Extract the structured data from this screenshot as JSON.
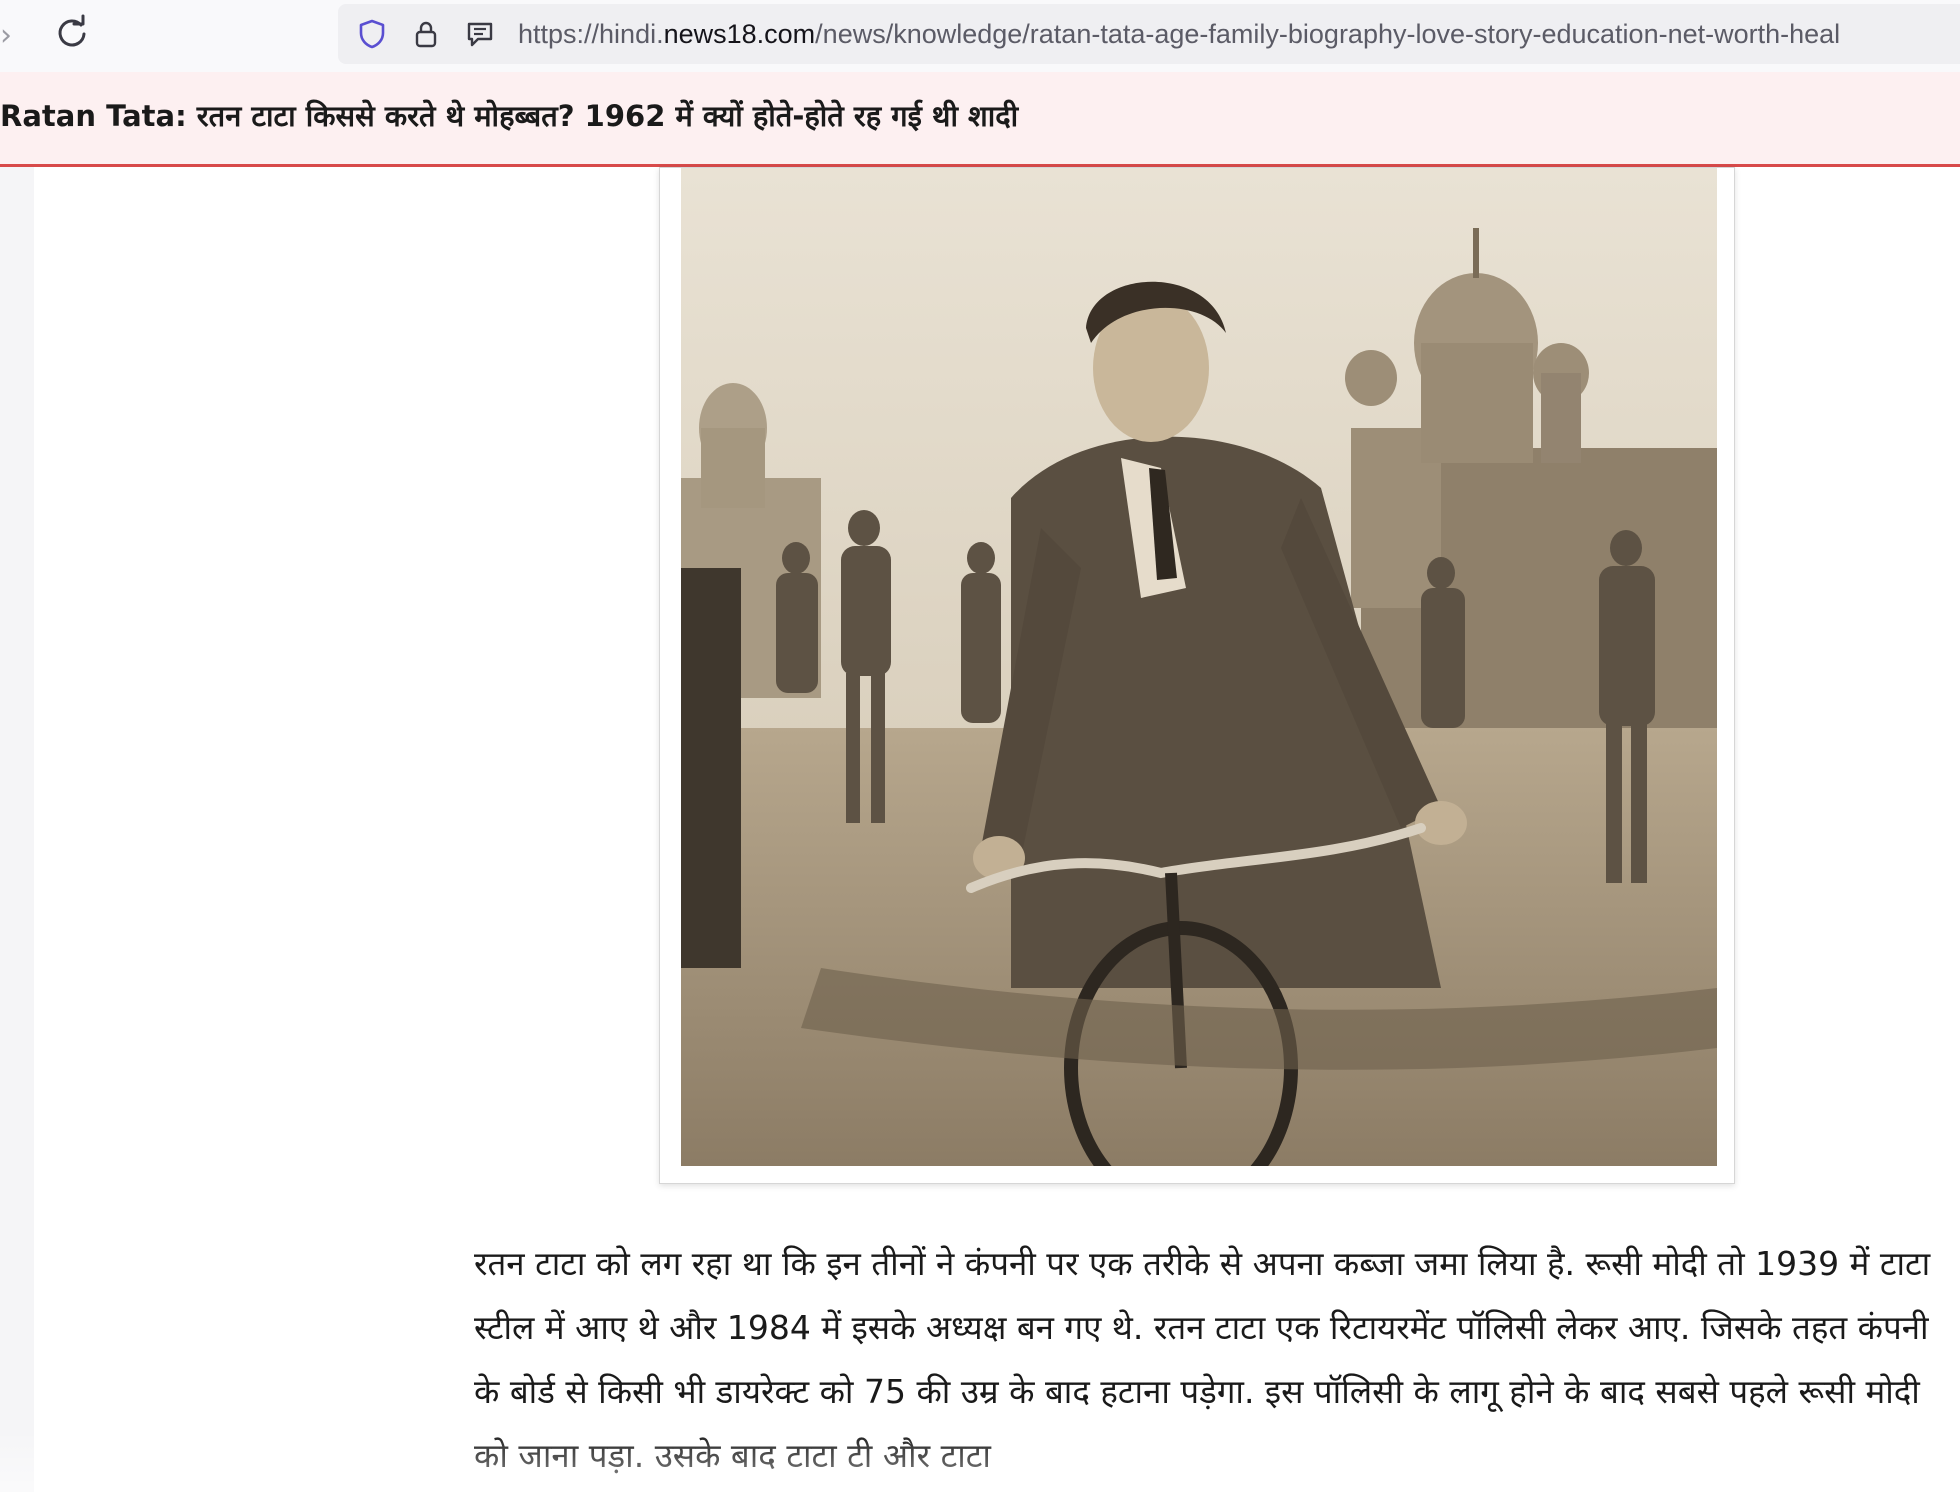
{
  "browser": {
    "url_prefix": "https://hindi.",
    "url_host": "news18.com",
    "url_path": "/news/knowledge/ratan-tata-age-family-biography-love-story-education-net-worth-heal",
    "icons": {
      "forward": "forward-arrow-icon",
      "reload": "reload-icon",
      "tracking": "shield-icon",
      "security": "lock-icon",
      "reader": "reader-view-icon"
    }
  },
  "header": {
    "headline": "Ratan Tata: रतन टाटा किससे करते थे मोहब्बत? 1962 में क्यों होते-होते रह गई थी शादी"
  },
  "article": {
    "photo_name": "young-man-on-bicycle-photo",
    "paragraph": "रतन टाटा को लग रहा था कि इन तीनों ने कंपनी पर एक तरीके से अपना कब्जा जमा लिया है. रूसी मोदी तो 1939 में टाटा स्टील में आए थे और 1984 में इसके अध्यक्ष बन गए थे. रतन टाटा एक रिटायरमेंट पॉलिसी लेकर आए. जिसके तहत कंपनी के बोर्ड से किसी भी डायरेक्ट को 75 की उम्र के बाद हटाना पड़ेगा. इस पॉलिसी के लागू होने के बाद सबसे पहले रूसी मोदी को जाना पड़ा. उसके बाद टाटा टी और टाटा"
  },
  "colors": {
    "headline_bg": "#fdf0f1",
    "headline_border": "#d84a4a",
    "sepia": "#b9a98f"
  }
}
